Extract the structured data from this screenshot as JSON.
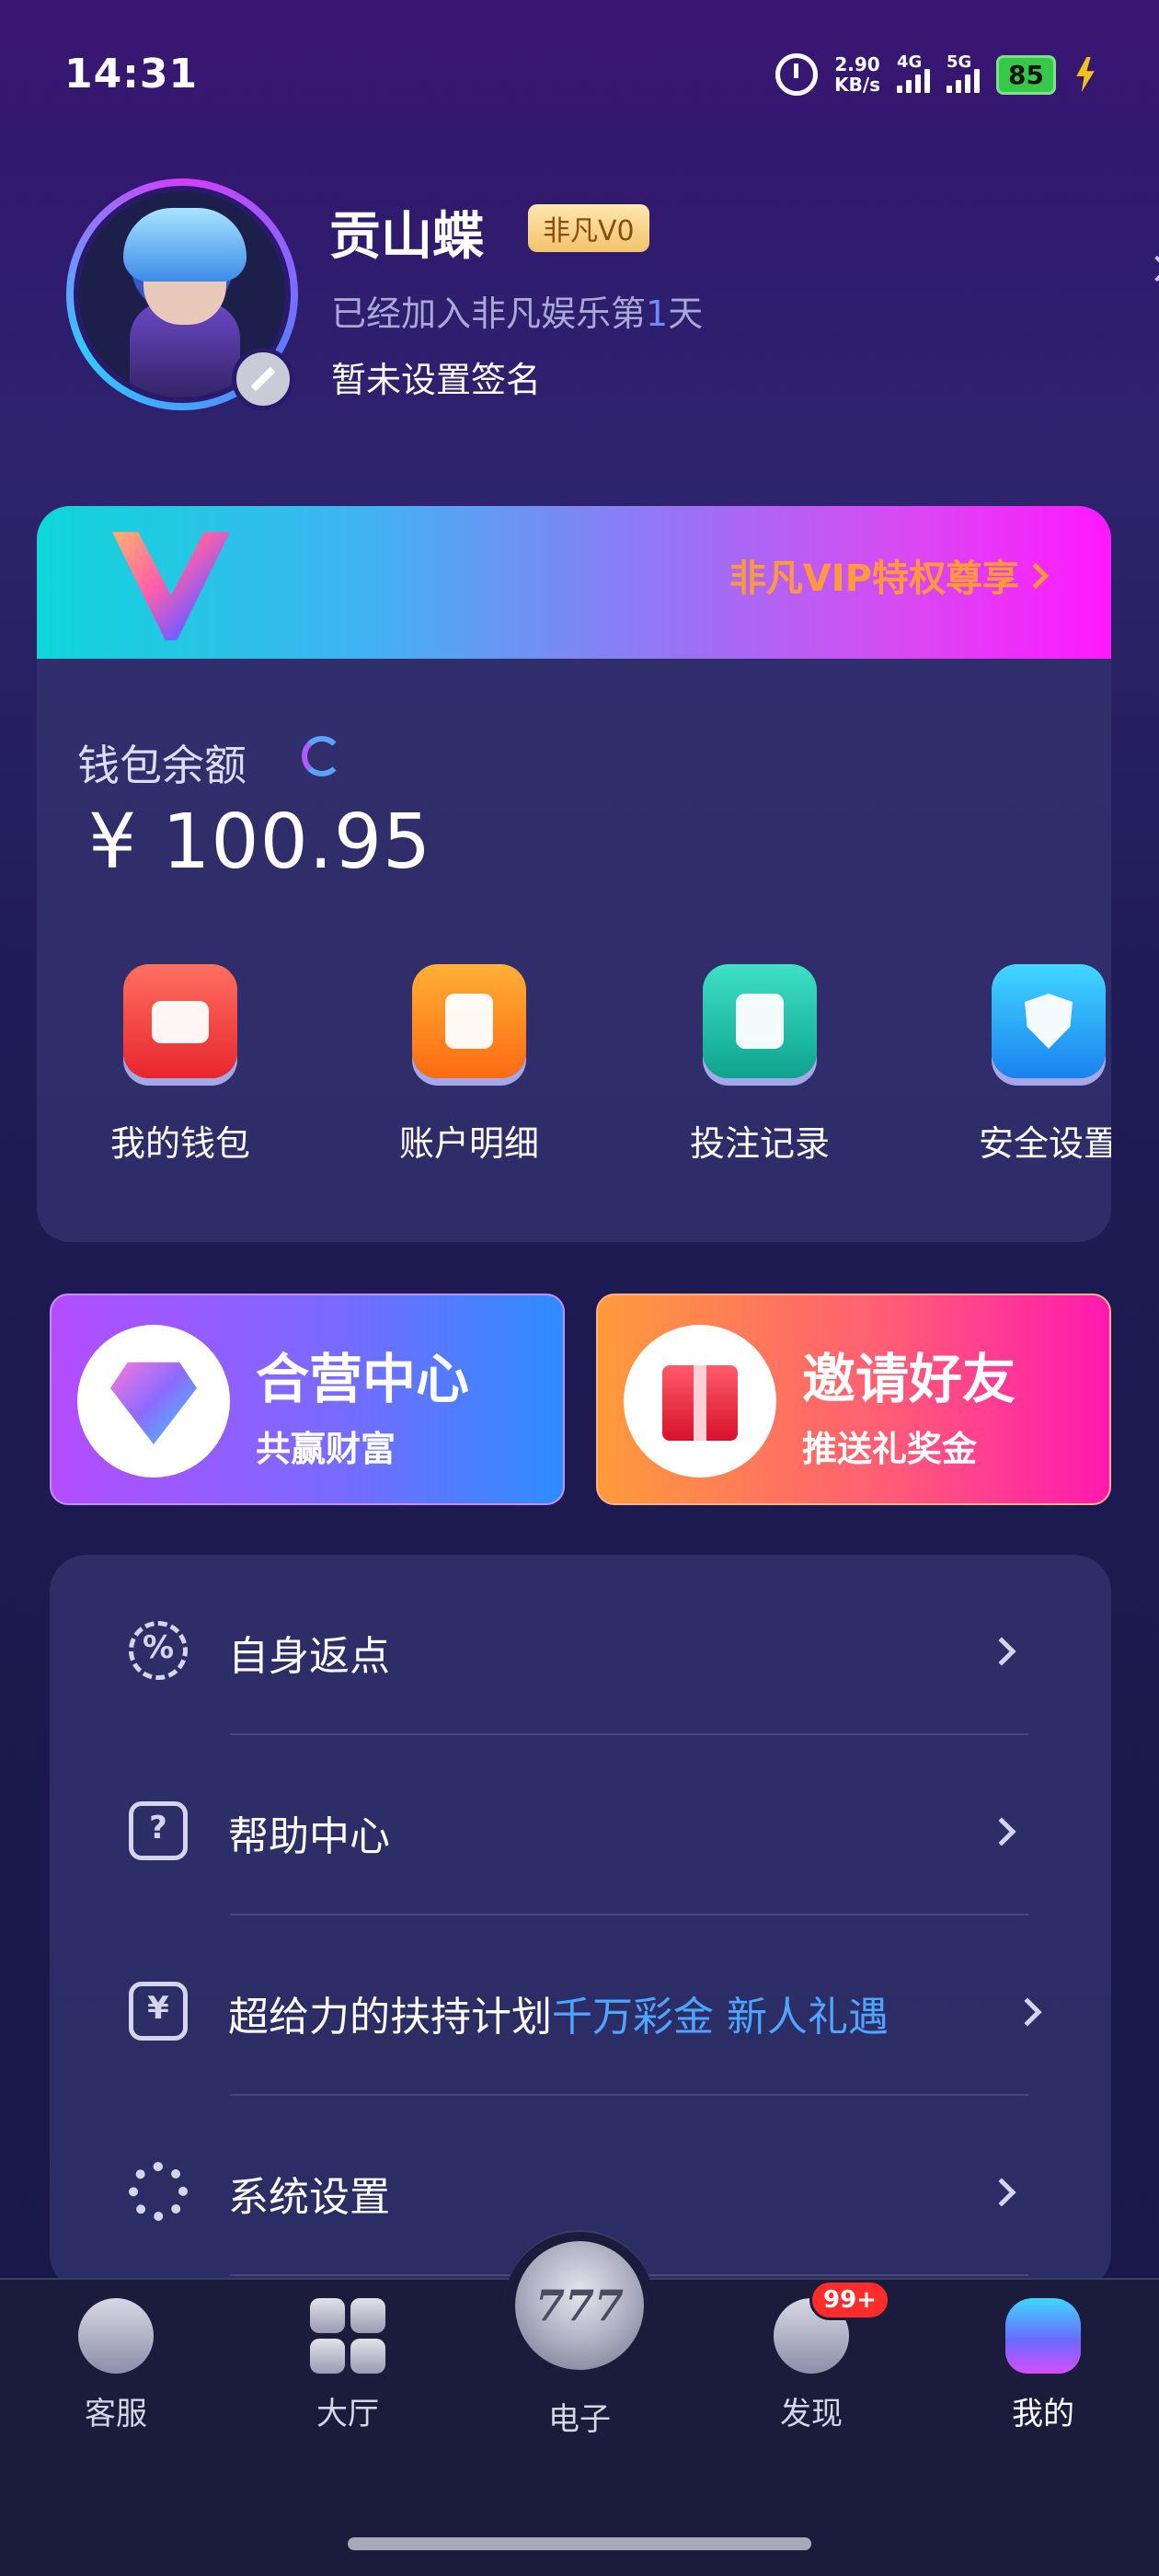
{
  "status_bar": {
    "time": "14:31",
    "net_speed_value": "2.90",
    "net_speed_unit": "KB/s",
    "signal_1": "4G",
    "signal_2": "5G",
    "battery": "85"
  },
  "profile": {
    "name": "贡山蝶",
    "vip_level": "非凡V0",
    "joined_prefix": "已经加入非凡娱乐第",
    "joined_days": "1",
    "joined_suffix": "天",
    "signature": "暂未设置签名"
  },
  "vip_banner": {
    "text": "非凡VIP特权尊享"
  },
  "wallet": {
    "label": "钱包余额",
    "balance": "¥ 100.95"
  },
  "quick_actions": [
    {
      "label": "我的钱包",
      "icon": "wallet-icon"
    },
    {
      "label": "账户明细",
      "icon": "account-details-icon"
    },
    {
      "label": "投注记录",
      "icon": "bet-record-icon"
    },
    {
      "label": "安全设置",
      "icon": "shield-icon"
    }
  ],
  "promos": {
    "agent": {
      "title": "合营中心",
      "subtitle": "共赢财富"
    },
    "invite": {
      "title": "邀请好友",
      "subtitle": "推送礼奖金"
    }
  },
  "menu": [
    {
      "label": "自身返点",
      "icon": "percent-badge-icon"
    },
    {
      "label": "帮助中心",
      "icon": "help-icon"
    },
    {
      "label": "超给力的扶持计划",
      "highlight": "千万彩金 新人礼遇",
      "icon": "gift-icon"
    },
    {
      "label": "系统设置",
      "icon": "gear-icon"
    }
  ],
  "bottom_nav": {
    "items": [
      {
        "label": "客服",
        "icon": "customer-service-icon"
      },
      {
        "label": "大厅",
        "icon": "lobby-grid-icon"
      },
      {
        "label": "电子",
        "icon": "slots-777-icon"
      },
      {
        "label": "发现",
        "icon": "discover-icon"
      },
      {
        "label": "我的",
        "icon": "profile-icon"
      }
    ],
    "discover_badge": "99+",
    "center_glyph": "777",
    "active": "我的"
  },
  "colors": {
    "highlight_blue": "#4ea5ff",
    "vip_orange": "#ff9a3c",
    "badge_red": "#ff2c2c"
  }
}
